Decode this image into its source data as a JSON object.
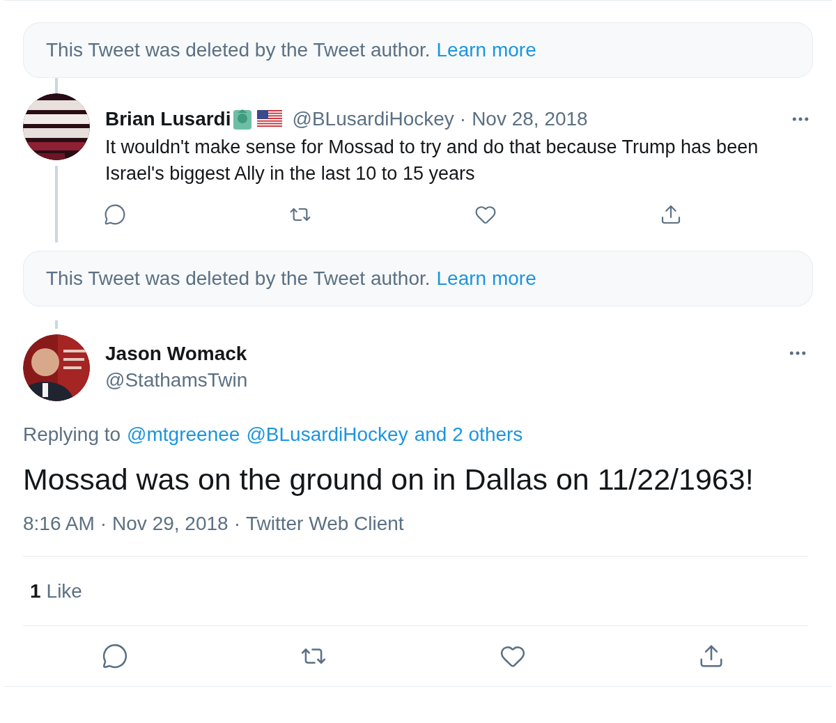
{
  "thread": [
    {
      "kind": "deleted",
      "text": "This Tweet was deleted by the Tweet author.",
      "link": "Learn more"
    },
    {
      "kind": "tweet",
      "name": "Brian Lusardi",
      "handle": "@BLusardiHockey",
      "separator": "·",
      "date": "Nov 28, 2018",
      "text": "It wouldn't make sense for Mossad to try and do that because Trump has been Israel's biggest Ally in the last 10 to 15 years"
    },
    {
      "kind": "deleted",
      "text": "This Tweet was deleted by the Tweet author.",
      "link": "Learn more"
    }
  ],
  "focal": {
    "name": "Jason Womack",
    "handle": "@StathamsTwin",
    "replying_label": "Replying to",
    "replying_links": [
      "@mtgreenee",
      "@BLusardiHockey",
      "and 2 others"
    ],
    "text": "Mossad was on the ground on in Dallas on 11/22/1963!",
    "time": "8:16 AM",
    "date": "Nov 29, 2018",
    "client": "Twitter Web Client",
    "separator": "·",
    "likes_count": "1",
    "likes_label": "Like"
  }
}
